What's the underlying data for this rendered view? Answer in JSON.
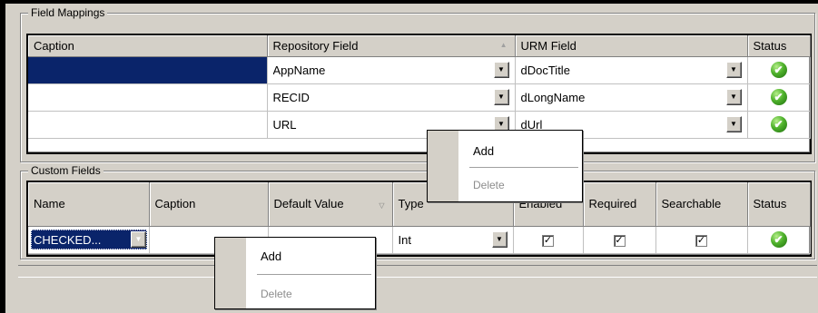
{
  "field_mappings": {
    "title": "Field Mappings",
    "columns": {
      "caption": "Caption",
      "repository_field": "Repository Field",
      "urm_field": "URM Field",
      "status": "Status"
    },
    "rows": [
      {
        "caption": "",
        "repository_field": "AppName",
        "urm_field": "dDocTitle",
        "status_icon": "check-circle-icon"
      },
      {
        "caption": "",
        "repository_field": "RECID",
        "urm_field": "dLongName",
        "status_icon": "check-circle-icon"
      },
      {
        "caption": "",
        "repository_field": "URL",
        "urm_field": "dUrl",
        "status_icon": "check-circle-icon"
      }
    ]
  },
  "custom_fields": {
    "title": "Custom Fields",
    "columns": {
      "name": "Name",
      "caption": "Caption",
      "default_value": "Default Value",
      "type": "Type",
      "enabled": "Enabled",
      "required": "Required",
      "searchable": "Searchable",
      "status": "Status"
    },
    "rows": [
      {
        "name": "CHECKED...",
        "caption": "",
        "default_value": "",
        "type": "Int",
        "enabled": true,
        "required": true,
        "searchable": true,
        "status_icon": "check-circle-icon"
      }
    ]
  },
  "context_menus": [
    {
      "items": [
        {
          "label": "Add",
          "enabled": true
        },
        {
          "label": "Delete",
          "enabled": false
        }
      ]
    },
    {
      "items": [
        {
          "label": "Add",
          "enabled": true
        },
        {
          "label": "Delete",
          "enabled": false
        }
      ]
    }
  ],
  "icons": {
    "checkbox_checked": "✓",
    "dropdown_arrow": "▼",
    "status_ok": "✔",
    "sort_asc": "▲",
    "sort_desc": "▽"
  },
  "colors": {
    "selection": "#0a246a",
    "status_ok": "#4fb22c",
    "window_bg": "#d4d0c8"
  }
}
